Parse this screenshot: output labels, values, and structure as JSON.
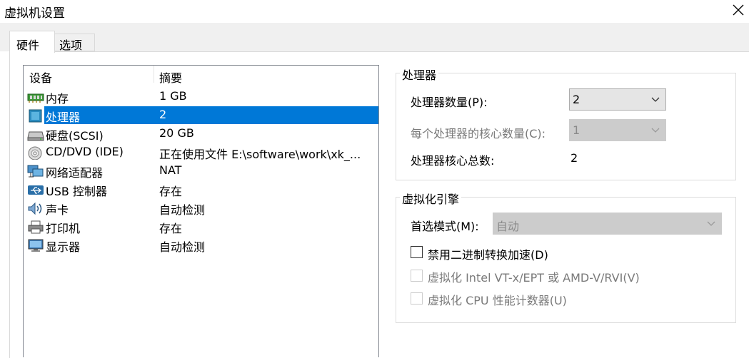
{
  "window": {
    "title": "虚拟机设置"
  },
  "tabs": [
    {
      "label": "硬件",
      "active": true
    },
    {
      "label": "选项",
      "active": false
    }
  ],
  "device_list": {
    "headers": [
      "设备",
      "摘要"
    ],
    "rows": [
      {
        "icon": "memory-icon",
        "name": "内存",
        "summary": "1 GB"
      },
      {
        "icon": "processor-icon",
        "name": "处理器",
        "summary": "2",
        "selected": true
      },
      {
        "icon": "harddisk-icon",
        "name": "硬盘(SCSI)",
        "summary": "20 GB"
      },
      {
        "icon": "cd-dvd-icon",
        "name": "CD/DVD (IDE)",
        "summary": "正在使用文件 E:\\software\\work\\xk_..."
      },
      {
        "icon": "network-adapter-icon",
        "name": "网络适配器",
        "summary": "NAT"
      },
      {
        "icon": "usb-icon",
        "name": "USB 控制器",
        "summary": "存在"
      },
      {
        "icon": "sound-card-icon",
        "name": "声卡",
        "summary": "自动检测"
      },
      {
        "icon": "printer-icon",
        "name": "打印机",
        "summary": "存在"
      },
      {
        "icon": "display-icon",
        "name": "显示器",
        "summary": "自动检测"
      }
    ]
  },
  "processor": {
    "group_title": "处理器",
    "count_label": "处理器数量(P):",
    "count_value": "2",
    "cores_label": "每个处理器的核心数量(C):",
    "cores_value": "1",
    "total_label": "处理器核心总数:",
    "total_value": "2"
  },
  "virtualization": {
    "group_title": "虚拟化引擎",
    "mode_label": "首选模式(M):",
    "mode_value": "自动",
    "options": [
      {
        "label": "禁用二进制转换加速(D)",
        "checked": false,
        "enabled": true
      },
      {
        "label": "虚拟化 Intel VT-x/EPT 或 AMD-V/RVI(V)",
        "checked": false,
        "enabled": false
      },
      {
        "label": "虚拟化 CPU 性能计数器(U)",
        "checked": false,
        "enabled": false
      }
    ]
  },
  "colors": {
    "selection": "#0078d7",
    "disabled_text": "#7a7a7a",
    "tab_background": "#f0f0f0"
  }
}
